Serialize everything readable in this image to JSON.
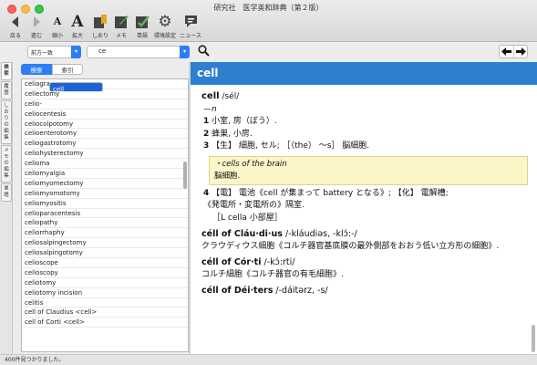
{
  "window": {
    "title": "研究社　医学英和辞典（第２版）"
  },
  "toolbar": [
    {
      "icon": "back-arrow-icon",
      "label": "戻る"
    },
    {
      "icon": "forward-arrow-icon",
      "label": "進む"
    },
    {
      "icon": "font-smaller-icon",
      "label": "縮小"
    },
    {
      "icon": "font-larger-icon",
      "label": "拡大"
    },
    {
      "icon": "bookmark-icon",
      "label": "しおり"
    },
    {
      "icon": "memo-icon",
      "label": "メモ"
    },
    {
      "icon": "wordbook-icon",
      "label": "単語"
    },
    {
      "icon": "gear-icon",
      "label": "環境設定"
    },
    {
      "icon": "news-icon",
      "label": "ニュース"
    }
  ],
  "search": {
    "mode": "前方一致",
    "query": "ce",
    "segments": [
      "検索",
      "索引"
    ]
  },
  "vtabs": [
    "検",
    "索",
    "履",
    "歴",
    "しおりの編集",
    "メモの編集",
    "単",
    "語"
  ],
  "list": {
    "items": [
      "celiagra",
      "celiectomy",
      "celio-",
      "celiocentesis",
      "celiocolpotomy",
      "celioenterotomy",
      "celiogastrotomy",
      "celiohysterectomy",
      "celioma",
      "celiomyalgia",
      "celiomyomectomy",
      "celiomyomotomy",
      "celiomyositis",
      "celioparacentesis",
      "celiopathy",
      "celiorrhaphy",
      "celiosalpingectomy",
      "celiosalpingotomy",
      "celioscope",
      "celioscopy",
      "celiotomy",
      "celiotomy incision",
      "celitis",
      "cell",
      "cell of Claudius <cell>",
      "cell of Corti <cell>"
    ],
    "selected_index": 23
  },
  "entry": {
    "header": "cell",
    "headword": "cell",
    "pron": " /sél/",
    "pos": "—n",
    "senses": [
      {
        "num": "1",
        "text": " 小室, 房（ぼう）."
      },
      {
        "num": "2",
        "text": " 蜂巣, 小房."
      },
      {
        "num": "3",
        "text": " 【生】 細胞, セル; ［（the） ～s］ 脳細胞."
      }
    ],
    "example_en": "・cells of the brain",
    "example_ja": "脳細胞.",
    "sense4": {
      "num": "4",
      "text": " 【電】 電池《cell が集まって battery となる》; 【化】 電解槽;"
    },
    "sense4b": "《発電所・変電所の》隔室.",
    "etym": "［L cella 小部屋］",
    "subentries": [
      {
        "hw": "céll of Cláu·di·us",
        "pron": " /-kláudiəs, -klɔ́:-/",
        "def": "クラウディウス細胞《コルチ器官基底膜の最外側部をおおう低い立方形の細胞》."
      },
      {
        "hw": "céll of Cór·ti",
        "pron": " /-kɔ́:rti/",
        "def": "コルチ細胞《コルチ器官の有毛細胞》."
      },
      {
        "hw": "céll of Déi·ters",
        "pron": " /-dáitərz, -s/",
        "def": ""
      }
    ]
  },
  "status": "400件見つかりました。",
  "colors": {
    "accent": "#2d7df6",
    "header_bar": "#2f7fd0",
    "selection": "#1d63d8",
    "example_bg": "#fbf6c7"
  }
}
